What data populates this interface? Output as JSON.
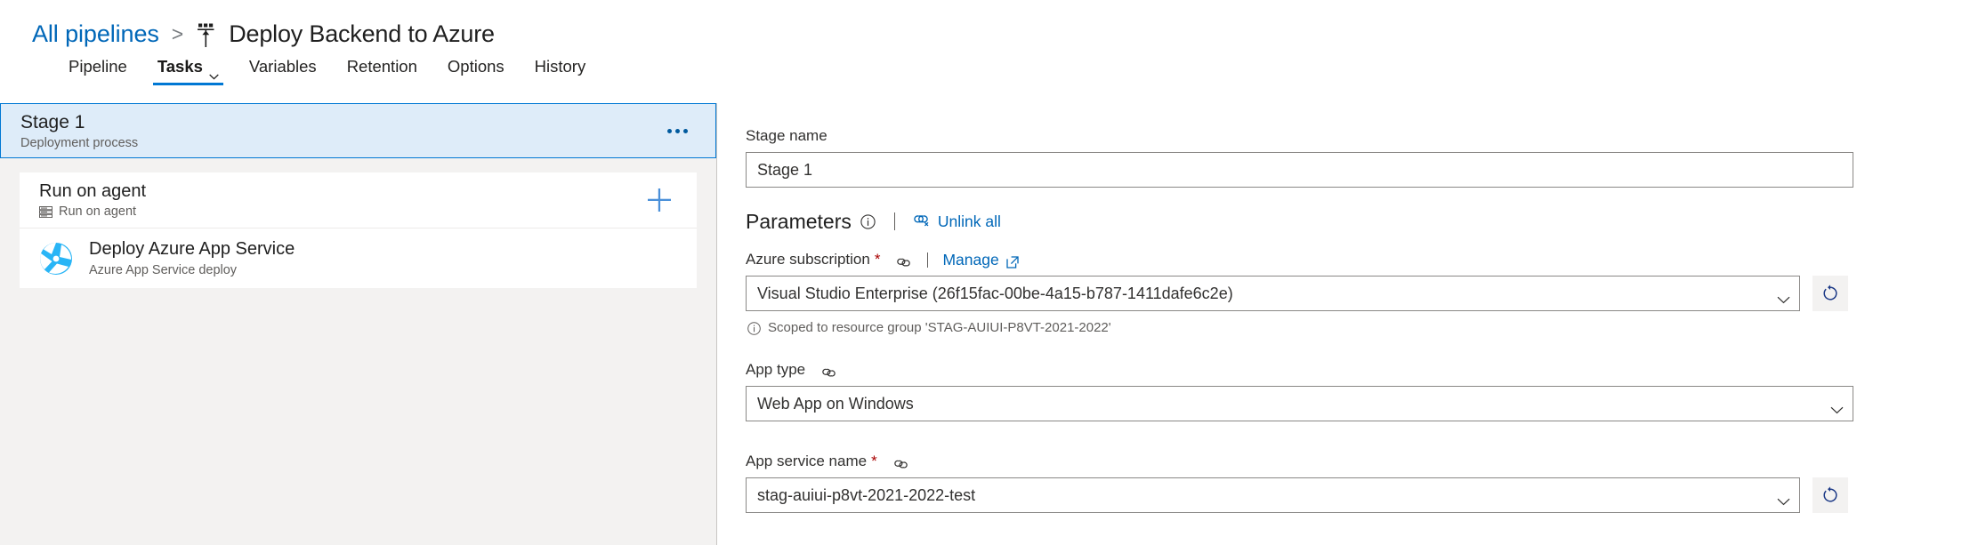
{
  "header": {
    "breadcrumb_root": "All pipelines",
    "breadcrumb_separator": ">",
    "pipeline_title": "Deploy Backend to Azure",
    "pipeline_icon": "pipeline-icon"
  },
  "tabs": [
    {
      "label": "Pipeline",
      "active": false,
      "has_chevron": false
    },
    {
      "label": "Tasks",
      "active": true,
      "has_chevron": true
    },
    {
      "label": "Variables",
      "active": false,
      "has_chevron": false
    },
    {
      "label": "Retention",
      "active": false,
      "has_chevron": false
    },
    {
      "label": "Options",
      "active": false,
      "has_chevron": false
    },
    {
      "label": "History",
      "active": false,
      "has_chevron": false
    }
  ],
  "sidebar": {
    "stage": {
      "title": "Stage 1",
      "subtitle": "Deployment process",
      "more_icon": "ellipsis-icon"
    },
    "job": {
      "title": "Run on agent",
      "subtitle": "Run on agent",
      "subtitle_icon": "agent-pool-icon",
      "add_icon": "plus-icon"
    },
    "tasks": [
      {
        "title": "Deploy Azure App Service",
        "subtitle": "Azure App Service deploy",
        "icon": "azure-app-service-icon"
      }
    ]
  },
  "details": {
    "stage_name": {
      "label": "Stage name",
      "value": "Stage 1"
    },
    "parameters": {
      "title": "Parameters",
      "info_icon": "info-icon",
      "separator": "|",
      "unlink_all_label": "Unlink all",
      "unlink_all_icon": "unlink-icon"
    },
    "fields": [
      {
        "label": "Azure subscription",
        "required": true,
        "link_icon": "link-icon",
        "separator": "|",
        "manage_label": "Manage",
        "manage_icon": "external-link-icon",
        "value": "Visual Studio Enterprise (26f15fac-00be-4a15-b787-1411dafe6c2e)",
        "refresh_icon": "refresh-icon",
        "hint": "Scoped to resource group 'STAG-AUIUI-P8VT-2021-2022'",
        "hint_icon": "info-icon"
      },
      {
        "label": "App type",
        "required": false,
        "link_icon": "link-icon",
        "value": "Web App on Windows"
      },
      {
        "label": "App service name",
        "required": true,
        "link_icon": "link-icon",
        "value": "stag-auiui-p8vt-2021-2022-test",
        "refresh_icon": "refresh-icon"
      }
    ]
  },
  "colors": {
    "accent": "#0078d4",
    "link": "#0067b8",
    "selected_bg": "#deecf9",
    "required_star": "#a80000",
    "panel_bg": "#f3f2f1"
  }
}
